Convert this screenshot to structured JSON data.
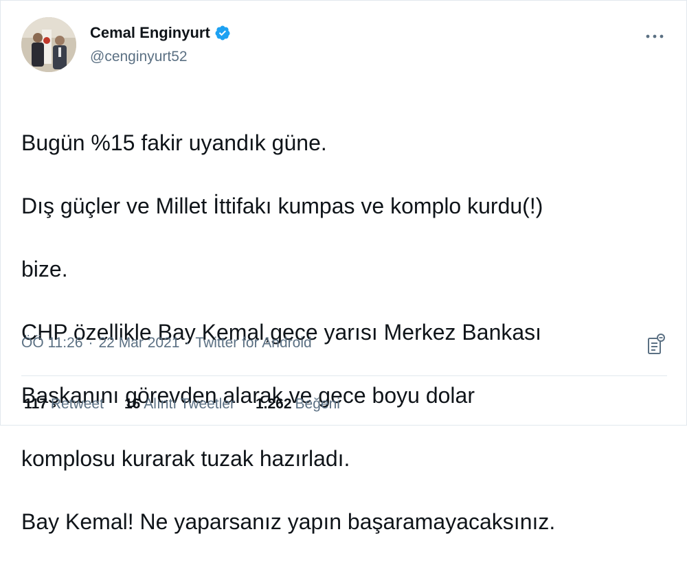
{
  "tweet": {
    "author": {
      "name": "Cemal Enginyurt",
      "handle": "@cenginyurt52",
      "verified": true
    },
    "text_lines": [
      "Bugün %15 fakir uyandık güne.",
      "Dış güçler ve Millet İttifakı kumpas ve komplo kurdu(!)",
      "bize.",
      "CHP özellikle Bay Kemal,gece yarısı Merkez Bankası",
      "Başkanını görevden alarak ve gece boyu dolar",
      "komplosu kurarak tuzak hazırladı.",
      "Bay Kemal! Ne yaparsanız yapın başaramayacaksınız."
    ],
    "time": "ÖÖ 11:26",
    "separator": "·",
    "date": "22 Mar 2021",
    "source": "Twitter for Android"
  },
  "stats": [
    {
      "count": "117",
      "label": "Retweet"
    },
    {
      "count": "16",
      "label": "Alıntı Tweetler"
    },
    {
      "count": "1.262",
      "label": "Beğeni"
    }
  ],
  "colors": {
    "verified": "#1da1f2",
    "secondary_text": "#5b7083",
    "primary_text": "#0f1419",
    "divider": "#e1e8ed"
  },
  "icons": {
    "more": "more-horizontal-icon",
    "verified": "verified-badge-icon",
    "analytics": "analytics-icon"
  }
}
